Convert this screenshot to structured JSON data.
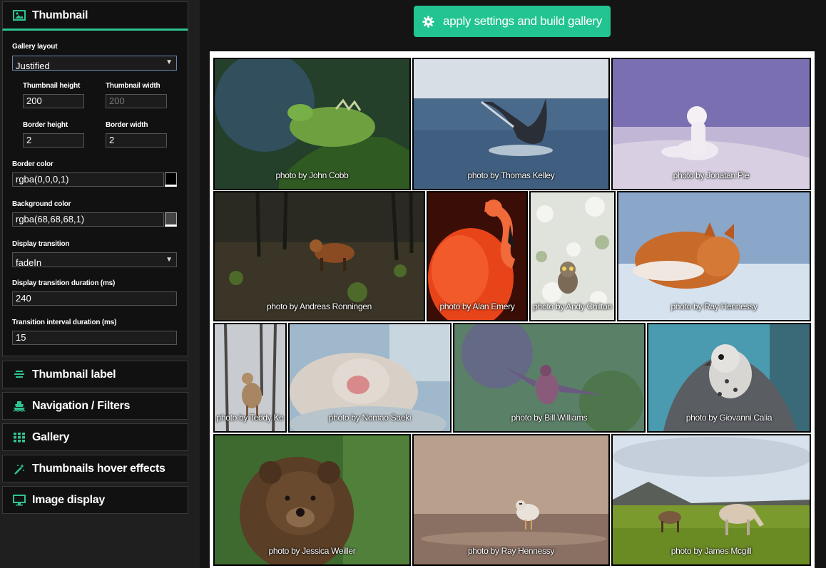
{
  "header": {
    "apply_label": "apply settings and build gallery"
  },
  "thumbnail_panel": {
    "title": "Thumbnail",
    "gallery_layout": {
      "label": "Gallery layout",
      "value": "Justified"
    },
    "thumb_height": {
      "label": "Thumbnail height",
      "value": "200"
    },
    "thumb_width": {
      "label": "Thumbnail width",
      "value": "200"
    },
    "border_height": {
      "label": "Border height",
      "value": "2"
    },
    "border_width": {
      "label": "Border width",
      "value": "2"
    },
    "border_color": {
      "label": "Border color",
      "value": "rgba(0,0,0,1)",
      "swatch": "#000000"
    },
    "background_color": {
      "label": "Background color",
      "value": "rgba(68,68,68,1)",
      "swatch": "#444444"
    },
    "display_transition": {
      "label": "Display transition",
      "value": "fadeIn"
    },
    "transition_duration": {
      "label": "Display transition duration (ms)",
      "value": "240"
    },
    "interval_duration": {
      "label": "Transition interval duration (ms)",
      "value": "15"
    }
  },
  "collapsed_panels": [
    {
      "label": "Thumbnail label",
      "icon": "align-center-icon"
    },
    {
      "label": "Navigation / Filters",
      "icon": "ship-icon"
    },
    {
      "label": "Gallery",
      "icon": "grid-icon"
    },
    {
      "label": "Thumbnails hover effects",
      "icon": "magic-wand-icon"
    },
    {
      "label": "Image display",
      "icon": "monitor-icon"
    }
  ],
  "gallery": {
    "thumbnails": [
      {
        "caption": "photo by John Cobb",
        "subject": "iguana"
      },
      {
        "caption": "photo by Thomas Kelley",
        "subject": "whale"
      },
      {
        "caption": "photo by Jonatan Pie",
        "subject": "arctic-fox"
      },
      {
        "caption": "photo by Andreas Ronningen",
        "subject": "fox-forest"
      },
      {
        "caption": "photo by Alan Emery",
        "subject": "flamingo"
      },
      {
        "caption": "photo by Andy Chilton",
        "subject": "owl"
      },
      {
        "caption": "photo by Ray Hennessy",
        "subject": "red-fox"
      },
      {
        "caption": "photo by Teddy Ke",
        "subject": "deer"
      },
      {
        "caption": "photo by Nomao Saeki",
        "subject": "snow-monkey"
      },
      {
        "caption": "photo by Bill Williams",
        "subject": "hummingbird"
      },
      {
        "caption": "photo by Giovanni Calia",
        "subject": "falcon"
      },
      {
        "caption": "photo by Jessica Weiller",
        "subject": "bear"
      },
      {
        "caption": "photo by Ray Hennessy",
        "subject": "plover"
      },
      {
        "caption": "photo by James Mcgill",
        "subject": "horses"
      }
    ]
  },
  "colors": {
    "accent": "#22c491",
    "panel": "#111111",
    "sidebar": "#1f1f1f"
  }
}
